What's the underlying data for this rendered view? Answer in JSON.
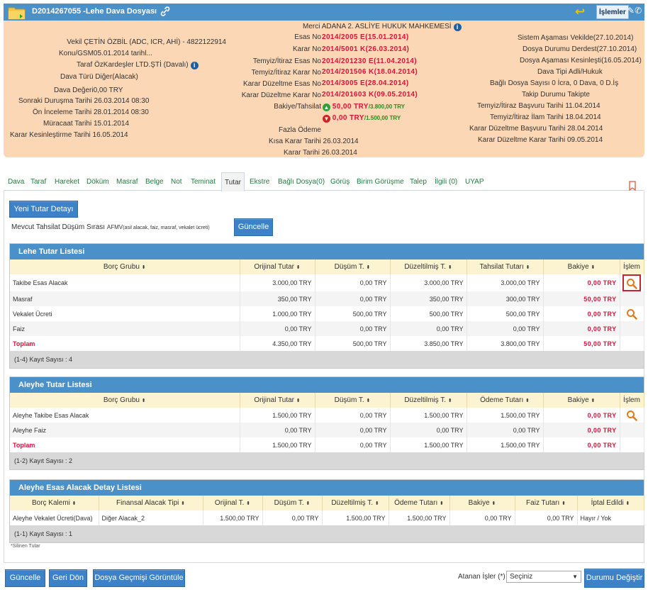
{
  "header": {
    "title": "D2014267055 -Lehe Dava Dosyası",
    "islemler_label": "İşlemler"
  },
  "info": {
    "left": [
      {
        "label": "Vekil",
        "value": "ÇETİN ÖZBİL (ADC, ICR, AHİ) - 4822122914"
      },
      {
        "label": "Konu/GSM",
        "value": "05.01.2014 tarihl..."
      },
      {
        "label": "Taraf",
        "value": "ÖzKardeşler LTD.ŞTİ  (Davalı)"
      },
      {
        "label": "Dava Türü",
        "value": "Diğer(Alacak)"
      },
      {
        "label": "Dava Değeri",
        "value": "0,00 TRY"
      },
      {
        "label": "Sonraki Duruşma Tarihi",
        "value": "26.03.2014 08:30"
      },
      {
        "label": "Ön İnceleme Tarihi",
        "value": "28.01.2014 08:30"
      },
      {
        "label": "Müracaat Tarihi",
        "value": "15.01.2014"
      },
      {
        "label": "Karar Kesinleştirme Tarihi",
        "value": "16.05.2014"
      }
    ],
    "middle": {
      "merci_label": "Merci",
      "merci_value": "ADANA 2. ASLİYE HUKUK MAHKEMESİ",
      "esas_label": "Esas No",
      "esas_value": "2014/2005 E(15.01.2014)",
      "karar_label": "Karar No",
      "karar_value": "2014/5001 K(26.03.2014)",
      "temyiz_esas_label": "Temyiz/İtiraz Esas No",
      "temyiz_esas_value": "2014/201230 E(11.04.2014)",
      "temyiz_karar_label": "Temyiz/İtiraz Karar No",
      "temyiz_karar_value": "2014/201506 K(18.04.2014)",
      "kd_esas_label": "Karar Düzeltme Esas No",
      "kd_esas_value": "2014/3005 E(28.04.2014)",
      "kd_karar_label": "Karar Düzeltme Karar No",
      "kd_karar_value": "2014/201603 K(09.05.2014)",
      "bakiye_label": "Bakiye/Tahsilat",
      "bakiye_up_main": "50,00 TRY",
      "bakiye_up_sub": "/3.800,00 TRY",
      "bakiye_dn_main": "0,00 TRY",
      "bakiye_dn_sub": "/1.500,00 TRY",
      "fazla_label": "Fazla Ödeme",
      "kisa_label": "Kısa Karar Tarihi",
      "kisa_value": "26.03.2014",
      "karar_tarihi_label": "Karar Tarihi",
      "karar_tarihi_value": "26.03.2014"
    },
    "right": [
      {
        "label": "Sistem Aşaması",
        "value": "Vekilde(27.10.2014)"
      },
      {
        "label": "Dosya Durumu",
        "value": "Derdest(27.10.2014)"
      },
      {
        "label": "Dosya Aşaması",
        "value": "Kesinleşti(16.05.2014)"
      },
      {
        "label": "Dava Tipi",
        "value": "Adli/Hukuk"
      },
      {
        "label": "Bağlı Dosya Sayısı",
        "value": "0 İcra, 0 Dava, 0 D.İş"
      },
      {
        "label": "Takip Durumu",
        "value": "Takipte"
      },
      {
        "label": "Temyiz/İtiraz Başvuru Tarihi",
        "value": "11.04.2014"
      },
      {
        "label": "Temyiz/İtiraz İlam Tarihi",
        "value": "18.04.2014"
      },
      {
        "label": "Karar Düzeltme Başvuru Tarihi",
        "value": "28.04.2014"
      },
      {
        "label": "Karar Düzeltme Karar Tarihi",
        "value": "09.05.2014"
      }
    ]
  },
  "tabs": [
    "Dava",
    "Taraf",
    "Hareket",
    "Döküm",
    "Masraf",
    "Belge",
    "Not",
    "Teminat",
    "Tutar",
    "Ekstre",
    "Bağlı Dosya(0)",
    "Görüş",
    "Birim Görüşme",
    "Talep",
    "İlgili (0)",
    "UYAP"
  ],
  "active_tab": "Tutar",
  "actions": {
    "yeni_tutar": "Yeni Tutar Detayı",
    "siralama_label": "Mevcut Tahsilat Düşüm Sırası",
    "siralama_code": "AFMV",
    "siralama_desc": "(asil alacak, faiz, masraf, vekalet ücreti)",
    "guncelle": "Güncelle"
  },
  "lehe": {
    "title": "Lehe Tutar Listesi",
    "headers": [
      "Borç Grubu",
      "Orijinal Tutar",
      "Düşüm T.",
      "Düzeltilmiş T.",
      "Tahsilat Tutarı",
      "Bakiye",
      "İşlem"
    ],
    "rows": [
      [
        "Takibe Esas Alacak",
        "3.000,00 TRY",
        "0,00 TRY",
        "3.000,00 TRY",
        "3.000,00 TRY",
        "0,00 TRY"
      ],
      [
        "Masraf",
        "350,00 TRY",
        "0,00 TRY",
        "350,00 TRY",
        "300,00 TRY",
        "50,00 TRY"
      ],
      [
        "Vekalet Ücreti",
        "1.000,00 TRY",
        "500,00 TRY",
        "500,00 TRY",
        "500,00 TRY",
        "0,00 TRY"
      ],
      [
        "Faiz",
        "0,00 TRY",
        "0,00 TRY",
        "0,00 TRY",
        "0,00 TRY",
        "0,00 TRY"
      ]
    ],
    "total": [
      "Toplam",
      "4.350,00 TRY",
      "500,00 TRY",
      "3.850,00 TRY",
      "3.800,00 TRY",
      "50,00 TRY"
    ],
    "count": "(1-4) Kayıt Sayısı : 4"
  },
  "aleyhe": {
    "title": "Aleyhe Tutar Listesi",
    "headers": [
      "Borç Grubu",
      "Orijinal Tutar",
      "Düşüm T.",
      "Düzeltilmiş T.",
      "Ödeme Tutarı",
      "Bakiye",
      "İşlem"
    ],
    "rows": [
      [
        "Aleyhe Takibe Esas Alacak",
        "1.500,00 TRY",
        "0,00 TRY",
        "1.500,00 TRY",
        "1.500,00 TRY",
        "0,00 TRY"
      ],
      [
        "Aleyhe Faiz",
        "0,00 TRY",
        "0,00 TRY",
        "0,00 TRY",
        "0,00 TRY",
        "0,00 TRY"
      ]
    ],
    "total": [
      "Toplam",
      "1.500,00 TRY",
      "0,00 TRY",
      "1.500,00 TRY",
      "1.500,00 TRY",
      "0,00 TRY"
    ],
    "count": "(1-2) Kayıt Sayısı : 2"
  },
  "detay": {
    "title": "Aleyhe Esas Alacak Detay Listesi",
    "headers": [
      "Borç Kalemi",
      "Finansal Alacak Tipi",
      "Orijinal T.",
      "Düşüm T.",
      "Düzeltilmiş T.",
      "Ödeme Tutarı",
      "Bakiye",
      "Faiz Tutarı",
      "İptal Edildi"
    ],
    "rows": [
      [
        "Aleyhe Vekalet Ücreti(Dava)",
        "Diğer Alacak_2",
        "1.500,00 TRY",
        "0,00 TRY",
        "1.500,00 TRY",
        "1.500,00 TRY",
        "0,00 TRY",
        "0,00 TRY",
        "Hayır / Yok"
      ]
    ],
    "count": "(1-1) Kayıt Sayısı : 1",
    "note": "*Silinen Tutar"
  },
  "bottom": {
    "guncelle": "Güncelle",
    "geri_don": "Geri Dön",
    "gecmis": "Dosya Geçmişi Görüntüle",
    "atanan_label": "Atanan İşler (*)",
    "select_value": "Seçiniz",
    "durumu_degistir": "Durumu Değiştir"
  },
  "colors": {
    "header_blue": "#4a90c9",
    "info_bg": "#fbd7b5",
    "accent_red": "#e0103c",
    "tab_green": "#267a3c"
  }
}
